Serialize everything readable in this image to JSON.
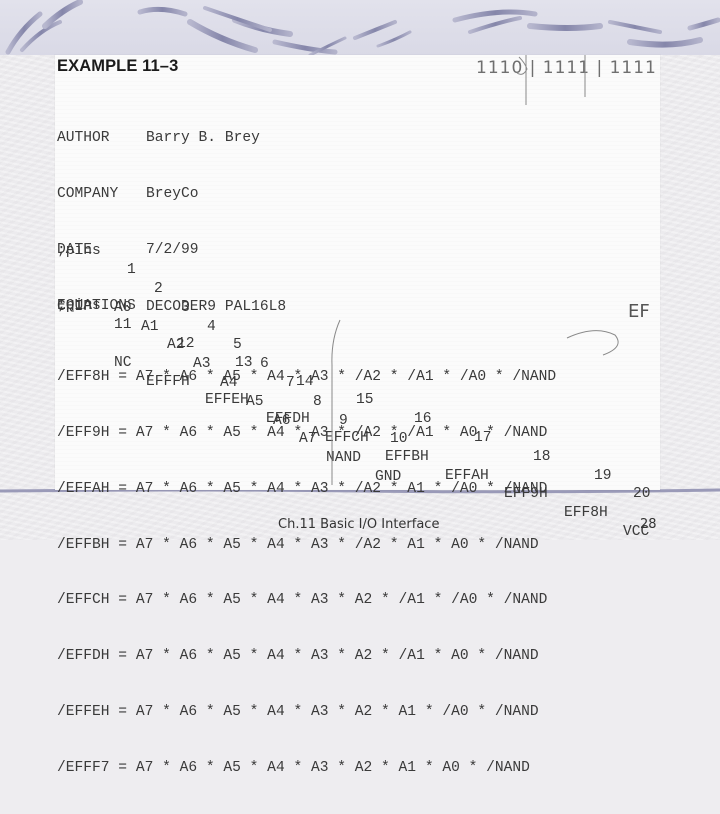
{
  "slide": {
    "title": "EXAMPLE 11–3",
    "footer_title": "Ch.11 Basic I/O Interface",
    "page_number": "28"
  },
  "header_fields": [
    {
      "key": "AUTHOR",
      "value": "Barry B. Brey"
    },
    {
      "key": "COMPANY",
      "value": "BreyCo"
    },
    {
      "key": "DATE",
      "value": "7/2/99"
    },
    {
      "key": "CHIP",
      "value": "DECODER9 PAL16L8"
    }
  ],
  "pins_label": ";pins",
  "pins_group1": {
    "numbers": [
      "1",
      "2",
      "3",
      "4",
      "5",
      "6",
      "7",
      "8",
      "9",
      "10"
    ],
    "names": [
      "A0",
      "A1",
      "A2",
      "A3",
      "A4",
      "A5",
      "A6",
      "A7",
      "NAND",
      "GND"
    ]
  },
  "pins_group2": {
    "numbers": [
      "11",
      "12",
      "13",
      "14",
      "15",
      "16",
      "17",
      "18",
      "19",
      "20"
    ],
    "names": [
      "NC",
      "EFFFH",
      "EFFEH",
      "EFFDH",
      "EFFCH",
      "EFFBH",
      "EFFAH",
      "EFF9H",
      "EFF8H",
      "VCC"
    ]
  },
  "equations_label": "EQUATIONS",
  "equations": [
    "/EFF8H = A7 * A6 * A5 * A4 * A3 * /A2 * /A1 * /A0 * /NAND",
    "/EFF9H = A7 * A6 * A5 * A4 * A3 * /A2 * /A1 * A0 * /NAND",
    "/EFFAH = A7 * A6 * A5 * A4 * A3 * /A2 * A1 * /A0 * /NAND",
    "/EFFBH = A7 * A6 * A5 * A4 * A3 * /A2 * A1 * A0 * /NAND",
    "/EFFCH = A7 * A6 * A5 * A4 * A3 * A2 * /A1 * /A0 * /NAND",
    "/EFFDH = A7 * A6 * A5 * A4 * A3 * A2 * /A1 * A0 * /NAND",
    "/EFFEH = A7 * A6 * A5 * A4 * A3 * A2 * A1 * /A0 * /NAND",
    "/EFFF7 = A7 * A6 * A5 * A4 * A3 * A2 * A1 * A0 * /NAND"
  ],
  "handwriting": {
    "bits": "1110 | 1111 | 1111",
    "note": "EF"
  },
  "colors": {
    "swoosh": "#8c8cb0",
    "text": "#3a3a3a",
    "title": "#1b1b1b"
  }
}
